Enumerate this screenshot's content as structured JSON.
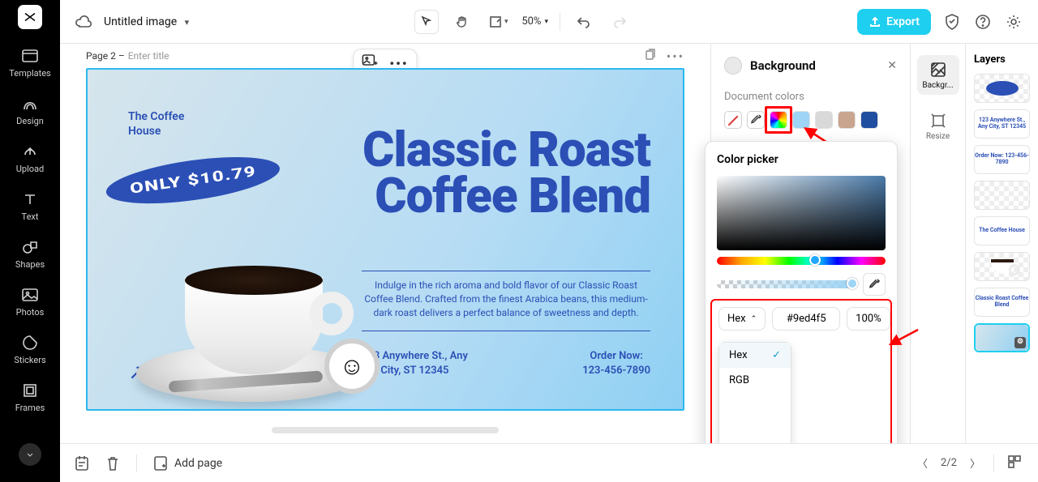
{
  "sidebar": {
    "items": [
      {
        "label": "Templates"
      },
      {
        "label": "Design"
      },
      {
        "label": "Upload"
      },
      {
        "label": "Text"
      },
      {
        "label": "Shapes"
      },
      {
        "label": "Photos"
      },
      {
        "label": "Stickers"
      },
      {
        "label": "Frames"
      }
    ]
  },
  "topbar": {
    "doc_title": "Untitled image",
    "zoom": "50%",
    "export_label": "Export"
  },
  "page_header": {
    "prefix": "Page 2 –",
    "placeholder": "Enter title"
  },
  "canvas": {
    "brand": "The Coffee House",
    "badge": "ONLY $10.79",
    "headline_line1": "Classic Roast",
    "headline_line2": "Coffee Blend",
    "body": "Indulge in the rich aroma and bold flavor of our Classic Roast Coffee Blend. Crafted from the finest Arabica beans, this medium-dark roast delivers a perfect balance of sweetness and depth.",
    "address_line1": "123 Anywhere St., Any",
    "address_line2": "City, ST 12345",
    "order_label": "Order Now:",
    "order_phone": "123-456-7890"
  },
  "right_panel": {
    "title": "Background",
    "section_label": "Document colors",
    "swatches": [
      "none",
      "eyedropper",
      "rainbow",
      "#9ed4f5",
      "#d9d9d9",
      "#c9a48f",
      "#1f4da0"
    ]
  },
  "picker": {
    "title": "Color picker",
    "format_label": "Hex",
    "hex_value": "#9ed4f5",
    "opacity": "100%",
    "format_options": [
      "Hex",
      "RGB"
    ],
    "format_selected": "Hex"
  },
  "side_tabs": {
    "items": [
      {
        "label": "Backgr..."
      },
      {
        "label": "Resize"
      }
    ]
  },
  "layers": {
    "title": "Layers",
    "thumbs": [
      {
        "kind": "oval"
      },
      {
        "kind": "text",
        "text": "123 Anywhere St., Any City, ST 12345"
      },
      {
        "kind": "text",
        "text": "Order Now: 123-456-7890"
      },
      {
        "kind": "checker"
      },
      {
        "kind": "text",
        "text": "The Coffee House"
      },
      {
        "kind": "cup"
      },
      {
        "kind": "text",
        "text": "Classic Roast Coffee Blend"
      },
      {
        "kind": "bg"
      }
    ]
  },
  "bottombar": {
    "add_page": "Add page",
    "page_indicator": "2/2"
  }
}
